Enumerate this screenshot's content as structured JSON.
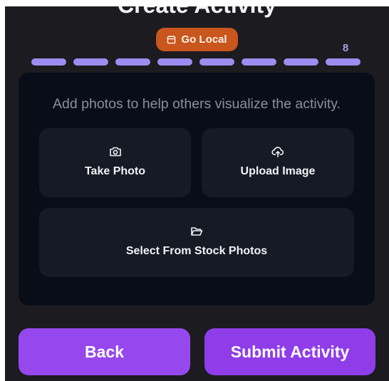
{
  "header": {
    "title": "Create Activity"
  },
  "badge": {
    "label": "Go Local",
    "icon": "calendar-icon",
    "color": "#c8561d"
  },
  "progress": {
    "current_step_label": "8",
    "total_segments": 8,
    "segment_color": "#9d8df0"
  },
  "photo_card": {
    "instructions": "Add photos to help others visualize the activity.",
    "options": {
      "take_photo": {
        "label": "Take Photo",
        "icon": "camera-icon"
      },
      "upload_image": {
        "label": "Upload Image",
        "icon": "cloud-upload-icon"
      },
      "stock_photos": {
        "label": "Select From Stock Photos",
        "icon": "folder-open-icon"
      }
    }
  },
  "footer": {
    "back_label": "Back",
    "submit_label": "Submit Activity",
    "accent_color": "#9648ee"
  }
}
